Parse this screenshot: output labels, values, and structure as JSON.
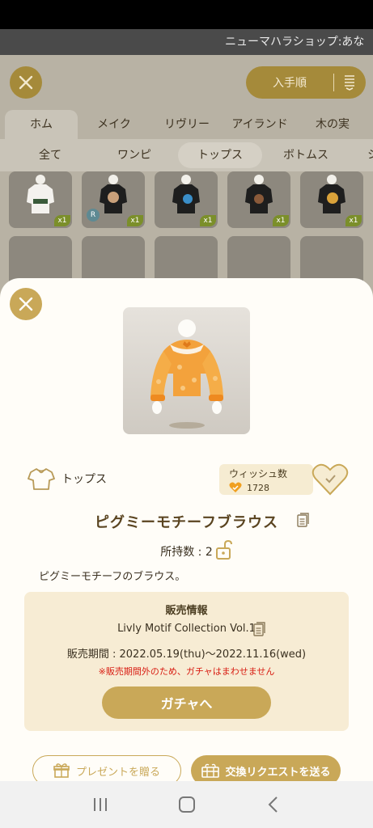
{
  "banner": {
    "text": "ニューマハラショップ:あな"
  },
  "sort": {
    "label": "入手順",
    "icon": "list-sort-icon"
  },
  "category_tabs": [
    "ホム",
    "メイク",
    "リヴリー",
    "アイランド",
    "木の実"
  ],
  "sub_tabs": [
    "全て",
    "ワンピ",
    "トップス",
    "ボトムス",
    "シ"
  ],
  "grid": {
    "items": [
      {
        "count": "x1",
        "badge": ""
      },
      {
        "count": "x1",
        "badge": "R"
      },
      {
        "count": "x1",
        "badge": ""
      },
      {
        "count": "x1",
        "badge": ""
      },
      {
        "count": "x1",
        "badge": ""
      }
    ]
  },
  "detail": {
    "category": "トップス",
    "wish_label": "ウィッシュ数",
    "wish_count": "1728",
    "name": "ピグミーモチーフブラウス",
    "owned": "所持数 : 2",
    "description": "ピグミーモチーフのブラウス。"
  },
  "sale": {
    "title": "販売情報",
    "collection": "Livly Motif Collection Vol.1",
    "period": "販売期間 : 2022.05.19(thu)〜2022.11.16(wed)",
    "warning": "※販売期間外のため、ガチャはまわせません",
    "gacha_button": "ガチャへ"
  },
  "actions": {
    "present": "プレゼントを贈る",
    "trade": "交換リクエストを送る"
  },
  "colors": {
    "accent": "#c9a858",
    "warning": "#d81c12",
    "sale_bg": "#f7ecd4"
  }
}
